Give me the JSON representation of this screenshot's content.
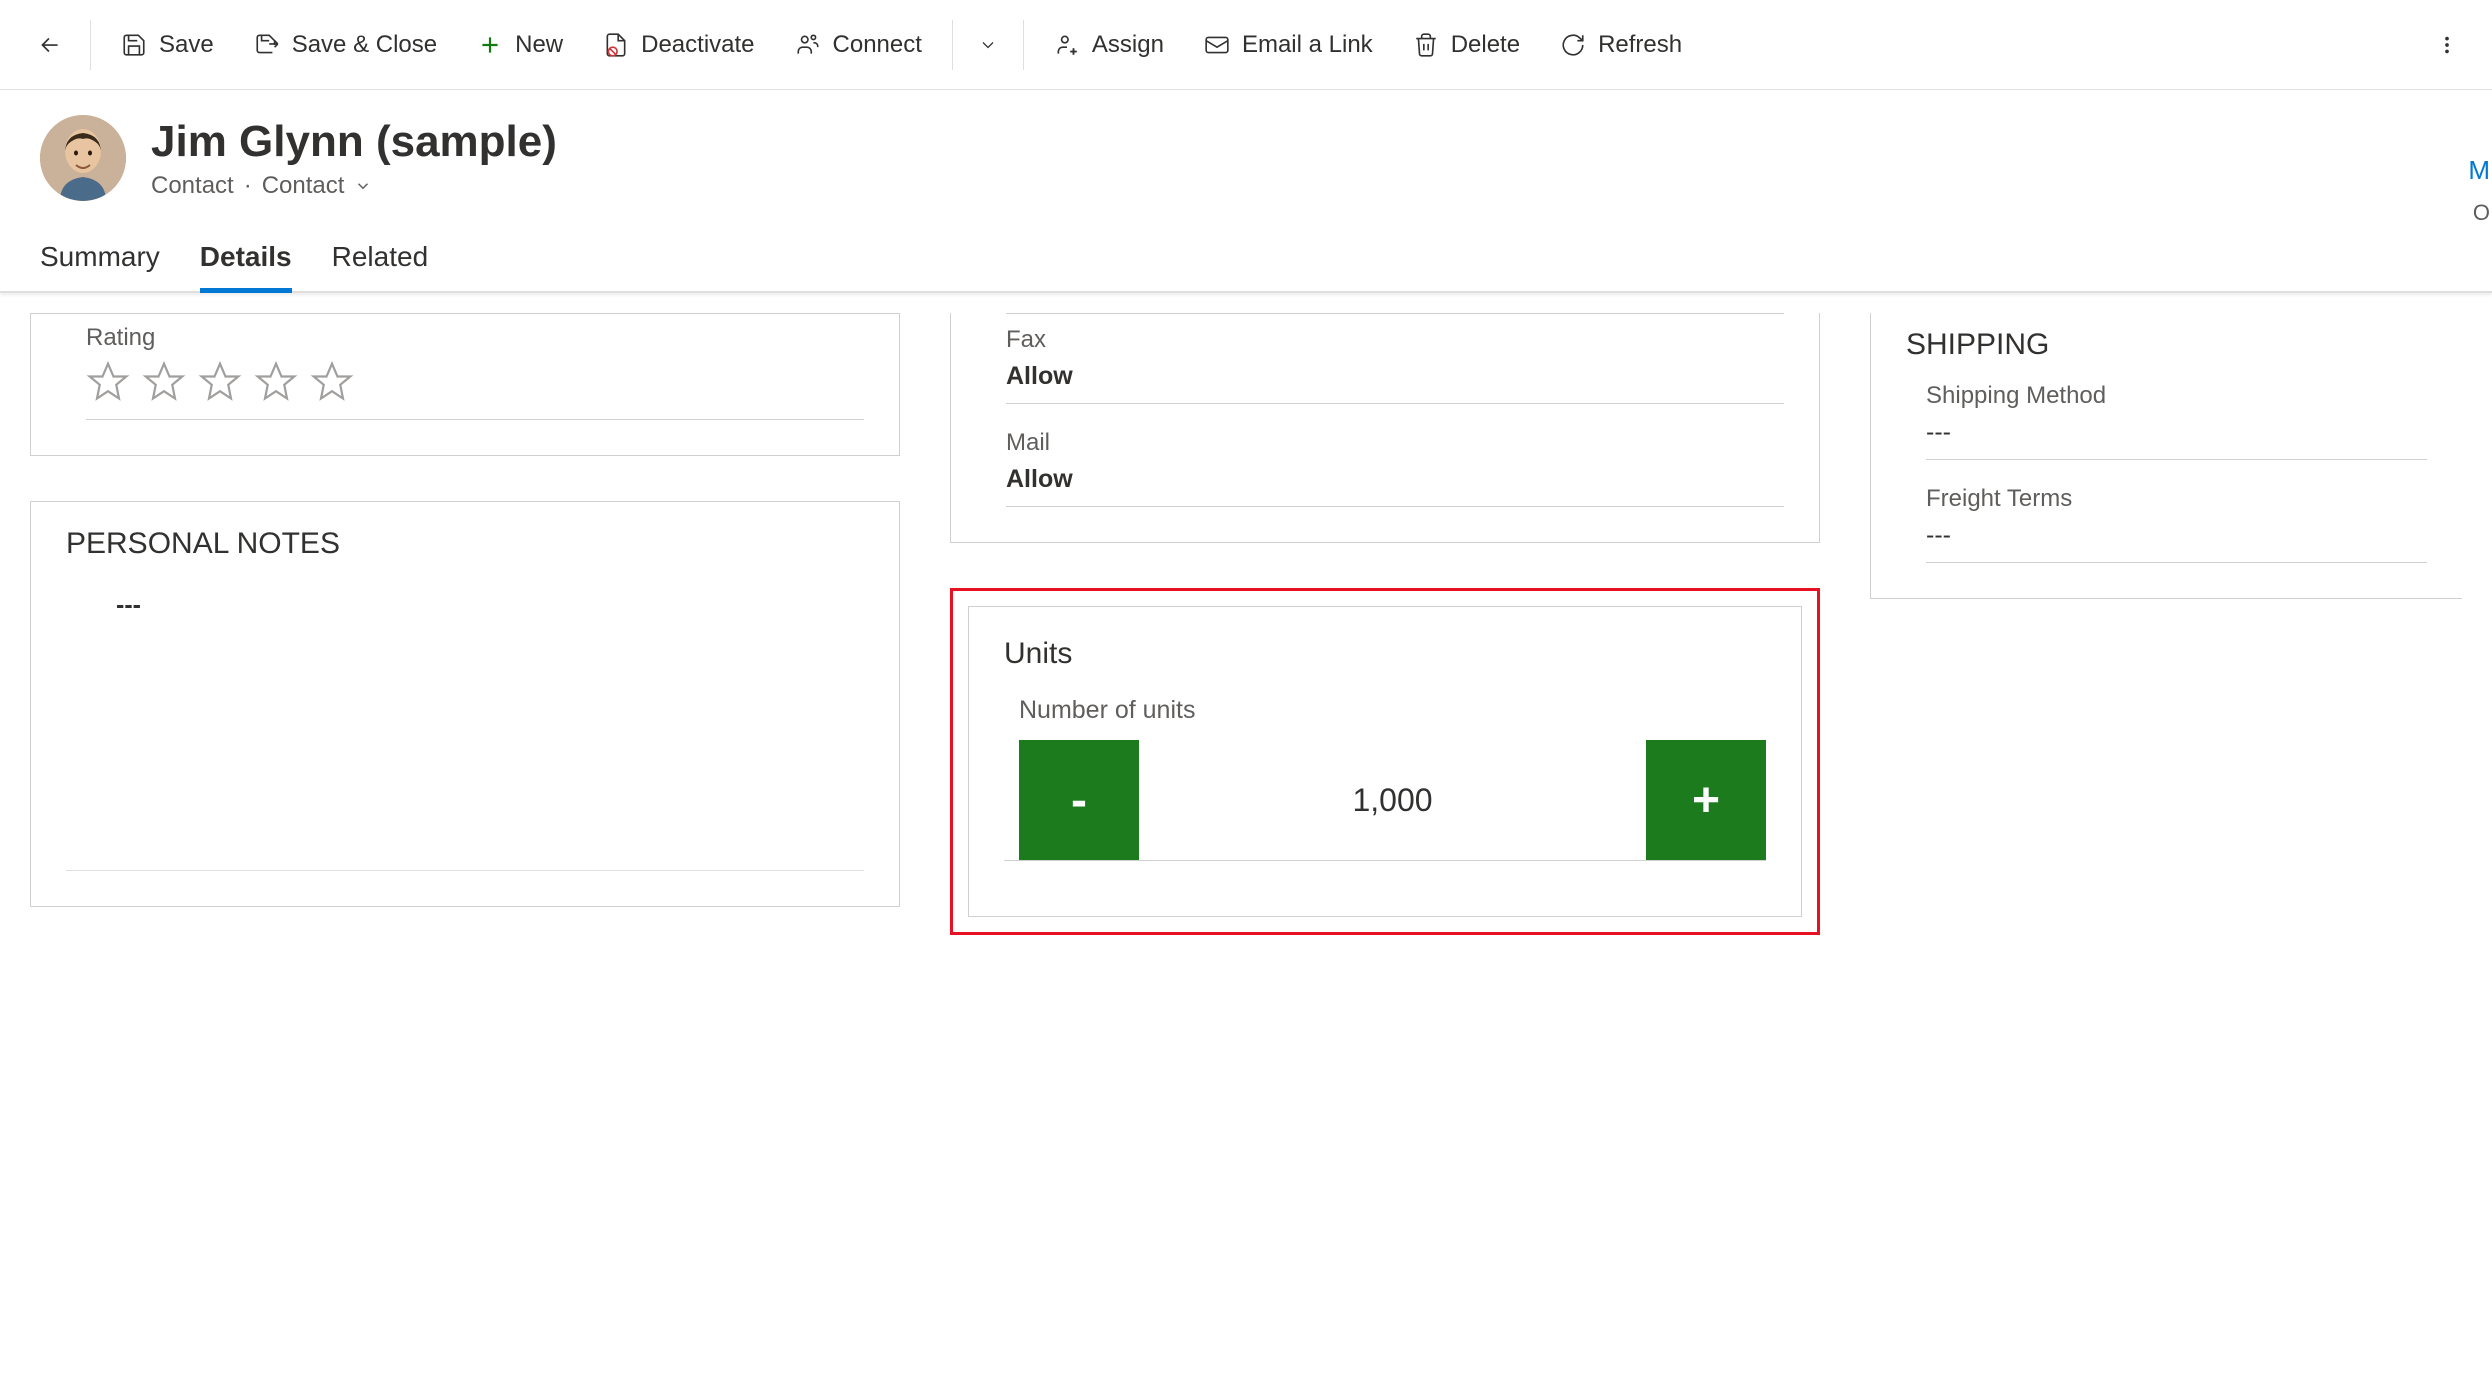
{
  "commands": {
    "save": "Save",
    "save_close": "Save & Close",
    "new": "New",
    "deactivate": "Deactivate",
    "connect": "Connect",
    "assign": "Assign",
    "email_link": "Email a Link",
    "delete": "Delete",
    "refresh": "Refresh"
  },
  "header": {
    "title": "Jim Glynn (sample)",
    "entity": "Contact",
    "form": "Contact",
    "right_m": "M",
    "right_o": "O"
  },
  "tabs": {
    "summary": "Summary",
    "details": "Details",
    "related": "Related"
  },
  "col1": {
    "rating_label": "Rating",
    "notes_title": "PERSONAL NOTES",
    "notes_value": "---"
  },
  "col2": {
    "fax_label": "Fax",
    "fax_value": "Allow",
    "mail_label": "Mail",
    "mail_value": "Allow",
    "units_title": "Units",
    "units_label": "Number of units",
    "units_value": "1,000",
    "minus": "-",
    "plus": "+"
  },
  "col3": {
    "shipping_title": "SHIPPING",
    "method_label": "Shipping Method",
    "method_value": "---",
    "freight_label": "Freight Terms",
    "freight_value": "---"
  }
}
